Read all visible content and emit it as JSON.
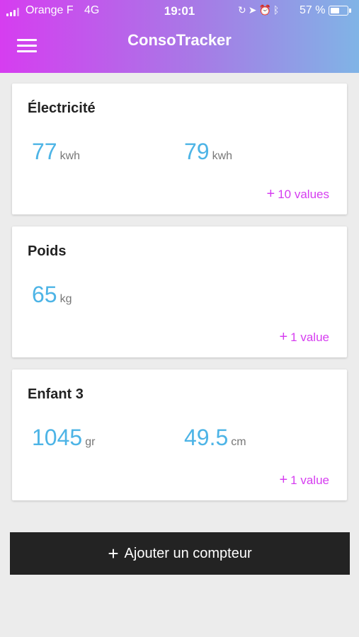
{
  "status_bar": {
    "carrier": "Orange F",
    "network": "4G",
    "time": "19:01",
    "icons": [
      "rotation-lock-icon",
      "location-icon",
      "alarm-icon",
      "bluetooth-icon"
    ],
    "battery_percent": "57 %",
    "battery_level": 0.57
  },
  "header": {
    "title": "ConsoTracker",
    "menu_icon": "hamburger-menu-icon",
    "gradient": [
      "#d63df0",
      "#80b4e6"
    ]
  },
  "colors": {
    "value": "#4db4e6",
    "accent": "#d63df0",
    "button": "#232323",
    "background": "#ececec"
  },
  "counters": [
    {
      "title": "Électricité",
      "readings": [
        {
          "value": "77",
          "unit": "kwh"
        },
        {
          "value": "79",
          "unit": "kwh"
        }
      ],
      "add_label": "10 values"
    },
    {
      "title": "Poids",
      "readings": [
        {
          "value": "65",
          "unit": "kg"
        }
      ],
      "add_label": "1 value"
    },
    {
      "title": "Enfant 3",
      "readings": [
        {
          "value": "1045",
          "unit": "gr"
        },
        {
          "value": "49.5",
          "unit": "cm"
        }
      ],
      "add_label": "1 value"
    }
  ],
  "add_counter_button": {
    "icon": "plus-icon",
    "label": "Ajouter un compteur"
  }
}
